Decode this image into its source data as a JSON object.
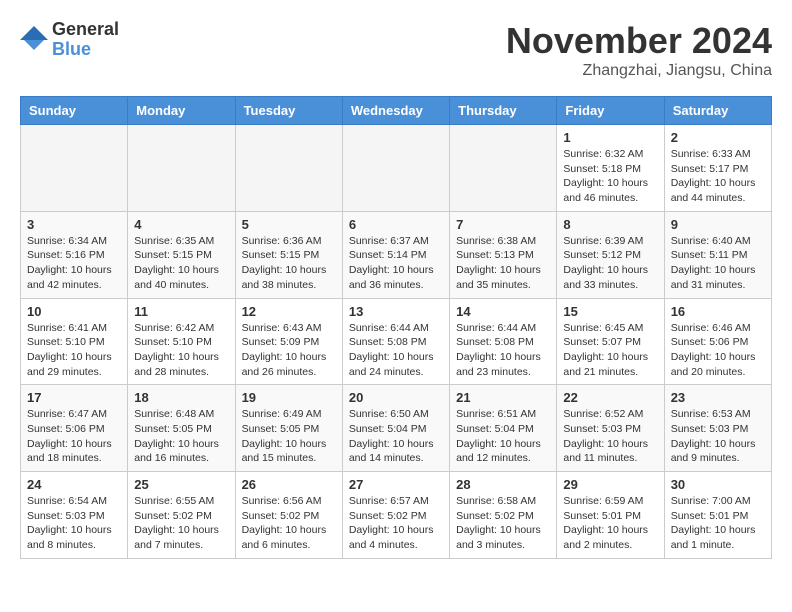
{
  "logo": {
    "general": "General",
    "blue": "Blue"
  },
  "title": {
    "month_year": "November 2024",
    "location": "Zhangzhai, Jiangsu, China"
  },
  "calendar": {
    "headers": [
      "Sunday",
      "Monday",
      "Tuesday",
      "Wednesday",
      "Thursday",
      "Friday",
      "Saturday"
    ],
    "weeks": [
      [
        {
          "day": "",
          "info": ""
        },
        {
          "day": "",
          "info": ""
        },
        {
          "day": "",
          "info": ""
        },
        {
          "day": "",
          "info": ""
        },
        {
          "day": "",
          "info": ""
        },
        {
          "day": "1",
          "info": "Sunrise: 6:32 AM\nSunset: 5:18 PM\nDaylight: 10 hours\nand 46 minutes."
        },
        {
          "day": "2",
          "info": "Sunrise: 6:33 AM\nSunset: 5:17 PM\nDaylight: 10 hours\nand 44 minutes."
        }
      ],
      [
        {
          "day": "3",
          "info": "Sunrise: 6:34 AM\nSunset: 5:16 PM\nDaylight: 10 hours\nand 42 minutes."
        },
        {
          "day": "4",
          "info": "Sunrise: 6:35 AM\nSunset: 5:15 PM\nDaylight: 10 hours\nand 40 minutes."
        },
        {
          "day": "5",
          "info": "Sunrise: 6:36 AM\nSunset: 5:15 PM\nDaylight: 10 hours\nand 38 minutes."
        },
        {
          "day": "6",
          "info": "Sunrise: 6:37 AM\nSunset: 5:14 PM\nDaylight: 10 hours\nand 36 minutes."
        },
        {
          "day": "7",
          "info": "Sunrise: 6:38 AM\nSunset: 5:13 PM\nDaylight: 10 hours\nand 35 minutes."
        },
        {
          "day": "8",
          "info": "Sunrise: 6:39 AM\nSunset: 5:12 PM\nDaylight: 10 hours\nand 33 minutes."
        },
        {
          "day": "9",
          "info": "Sunrise: 6:40 AM\nSunset: 5:11 PM\nDaylight: 10 hours\nand 31 minutes."
        }
      ],
      [
        {
          "day": "10",
          "info": "Sunrise: 6:41 AM\nSunset: 5:10 PM\nDaylight: 10 hours\nand 29 minutes."
        },
        {
          "day": "11",
          "info": "Sunrise: 6:42 AM\nSunset: 5:10 PM\nDaylight: 10 hours\nand 28 minutes."
        },
        {
          "day": "12",
          "info": "Sunrise: 6:43 AM\nSunset: 5:09 PM\nDaylight: 10 hours\nand 26 minutes."
        },
        {
          "day": "13",
          "info": "Sunrise: 6:44 AM\nSunset: 5:08 PM\nDaylight: 10 hours\nand 24 minutes."
        },
        {
          "day": "14",
          "info": "Sunrise: 6:44 AM\nSunset: 5:08 PM\nDaylight: 10 hours\nand 23 minutes."
        },
        {
          "day": "15",
          "info": "Sunrise: 6:45 AM\nSunset: 5:07 PM\nDaylight: 10 hours\nand 21 minutes."
        },
        {
          "day": "16",
          "info": "Sunrise: 6:46 AM\nSunset: 5:06 PM\nDaylight: 10 hours\nand 20 minutes."
        }
      ],
      [
        {
          "day": "17",
          "info": "Sunrise: 6:47 AM\nSunset: 5:06 PM\nDaylight: 10 hours\nand 18 minutes."
        },
        {
          "day": "18",
          "info": "Sunrise: 6:48 AM\nSunset: 5:05 PM\nDaylight: 10 hours\nand 16 minutes."
        },
        {
          "day": "19",
          "info": "Sunrise: 6:49 AM\nSunset: 5:05 PM\nDaylight: 10 hours\nand 15 minutes."
        },
        {
          "day": "20",
          "info": "Sunrise: 6:50 AM\nSunset: 5:04 PM\nDaylight: 10 hours\nand 14 minutes."
        },
        {
          "day": "21",
          "info": "Sunrise: 6:51 AM\nSunset: 5:04 PM\nDaylight: 10 hours\nand 12 minutes."
        },
        {
          "day": "22",
          "info": "Sunrise: 6:52 AM\nSunset: 5:03 PM\nDaylight: 10 hours\nand 11 minutes."
        },
        {
          "day": "23",
          "info": "Sunrise: 6:53 AM\nSunset: 5:03 PM\nDaylight: 10 hours\nand 9 minutes."
        }
      ],
      [
        {
          "day": "24",
          "info": "Sunrise: 6:54 AM\nSunset: 5:03 PM\nDaylight: 10 hours\nand 8 minutes."
        },
        {
          "day": "25",
          "info": "Sunrise: 6:55 AM\nSunset: 5:02 PM\nDaylight: 10 hours\nand 7 minutes."
        },
        {
          "day": "26",
          "info": "Sunrise: 6:56 AM\nSunset: 5:02 PM\nDaylight: 10 hours\nand 6 minutes."
        },
        {
          "day": "27",
          "info": "Sunrise: 6:57 AM\nSunset: 5:02 PM\nDaylight: 10 hours\nand 4 minutes."
        },
        {
          "day": "28",
          "info": "Sunrise: 6:58 AM\nSunset: 5:02 PM\nDaylight: 10 hours\nand 3 minutes."
        },
        {
          "day": "29",
          "info": "Sunrise: 6:59 AM\nSunset: 5:01 PM\nDaylight: 10 hours\nand 2 minutes."
        },
        {
          "day": "30",
          "info": "Sunrise: 7:00 AM\nSunset: 5:01 PM\nDaylight: 10 hours\nand 1 minute."
        }
      ]
    ]
  }
}
